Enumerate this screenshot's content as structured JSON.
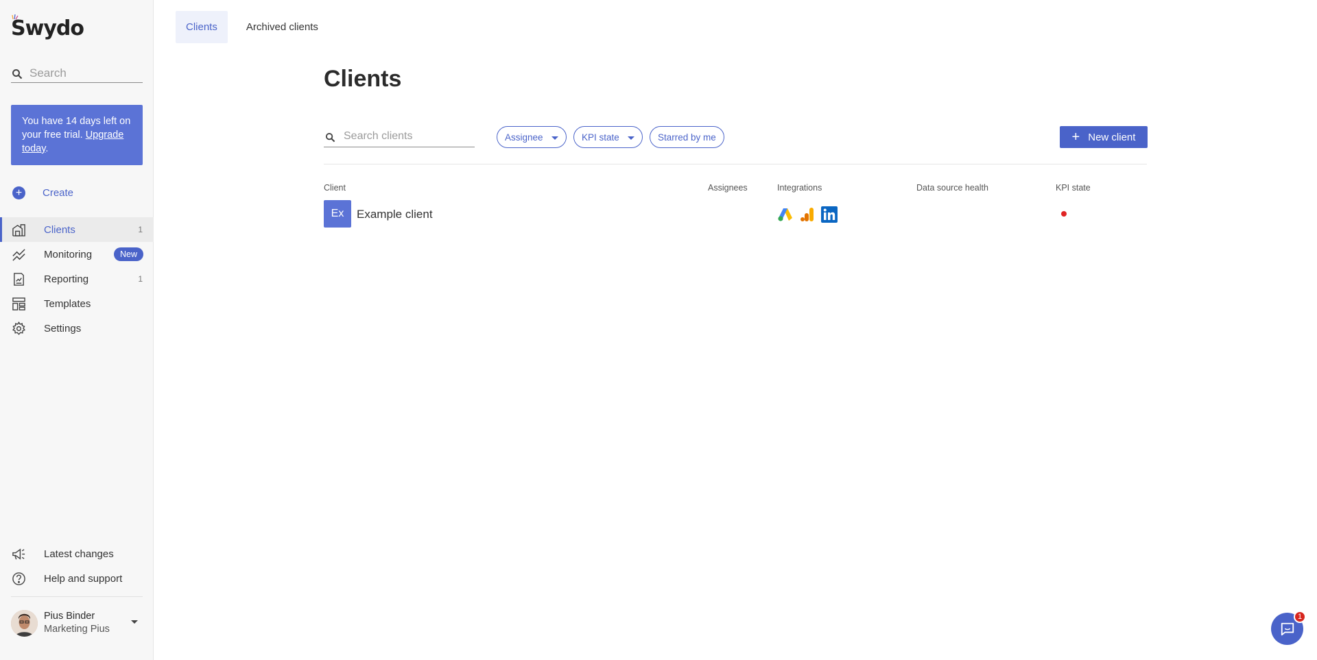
{
  "brand": {
    "logo_text": "Swydo",
    "accent": "#4a63c9"
  },
  "sidebar": {
    "search_placeholder": "Search",
    "trial": {
      "text": "You have 14 days left on your free trial.",
      "link": "Upgrade today",
      "after_link": "."
    },
    "create_label": "Create",
    "items": [
      {
        "label": "Clients",
        "count": "1",
        "icon": "building-icon",
        "active": true
      },
      {
        "label": "Monitoring",
        "badge": "New",
        "icon": "chart-trend-icon"
      },
      {
        "label": "Reporting",
        "count": "1",
        "icon": "report-icon"
      },
      {
        "label": "Templates",
        "icon": "templates-icon"
      },
      {
        "label": "Settings",
        "icon": "gear-icon"
      }
    ],
    "bottom_items": [
      {
        "label": "Latest changes",
        "icon": "megaphone-icon"
      },
      {
        "label": "Help and support",
        "icon": "help-icon"
      }
    ],
    "user": {
      "name": "Pius Binder",
      "org": "Marketing Pius"
    }
  },
  "tabs": [
    {
      "label": "Clients",
      "active": true
    },
    {
      "label": "Archived clients"
    }
  ],
  "main": {
    "title": "Clients",
    "search_placeholder": "Search clients",
    "filters": {
      "assignee": "Assignee",
      "kpi_state": "KPI state",
      "starred": "Starred by me"
    },
    "new_client_label": "New client",
    "columns": [
      "Client",
      "Assignees",
      "Integrations",
      "Data source health",
      "KPI state"
    ],
    "rows": [
      {
        "initials": "Ex",
        "name": "Example client",
        "integrations": [
          "google-ads-icon",
          "google-analytics-icon",
          "linkedin-icon"
        ],
        "kpi_state_color": "#e02424"
      }
    ]
  },
  "chat": {
    "notification_count": "1"
  }
}
